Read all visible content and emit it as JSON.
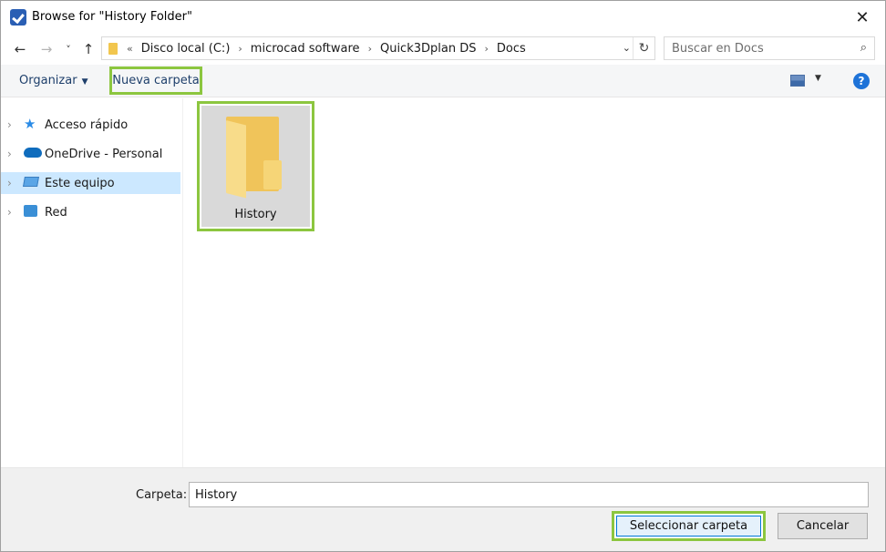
{
  "window": {
    "title": "Browse for \"History Folder\"",
    "close_glyph": "✕"
  },
  "nav": {
    "back_glyph": "←",
    "forward_glyph": "→",
    "recent_glyph": "˅",
    "up_glyph": "↑"
  },
  "address": {
    "overflow_glyph": "«",
    "separator_glyph": "›",
    "breadcrumbs": [
      "Disco local (C:)",
      "microcad software",
      "Quick3Dplan DS",
      "Docs"
    ],
    "dropdown_glyph": "⌄",
    "refresh_glyph": "↻"
  },
  "search": {
    "placeholder": "Buscar en Docs",
    "icon_glyph": "⌕"
  },
  "toolbar": {
    "organize_label": "Organizar",
    "organize_caret": "▼",
    "new_folder_label": "Nueva carpeta",
    "view_caret": "▼",
    "help_label": "?"
  },
  "sidebar": {
    "items": [
      {
        "label": "Acceso rápido",
        "icon": "quick-access-star-icon",
        "chevron": "›"
      },
      {
        "label": "OneDrive - Personal",
        "icon": "onedrive-cloud-icon",
        "chevron": "›"
      },
      {
        "label": "Este equipo",
        "icon": "this-pc-icon",
        "chevron": "›",
        "selected": true
      },
      {
        "label": "Red",
        "icon": "network-icon",
        "chevron": "›"
      }
    ]
  },
  "content": {
    "items": [
      {
        "label": "History",
        "icon": "folder-icon"
      }
    ]
  },
  "footer": {
    "folder_label": "Carpeta:",
    "folder_value": "History",
    "select_button": "Seleccionar carpeta",
    "cancel_button": "Cancelar"
  },
  "colors": {
    "highlight_border": "#8cc63f",
    "selection_bg": "#cce8ff",
    "link_text": "#1e3f6b",
    "help_blue": "#1e73d8"
  }
}
